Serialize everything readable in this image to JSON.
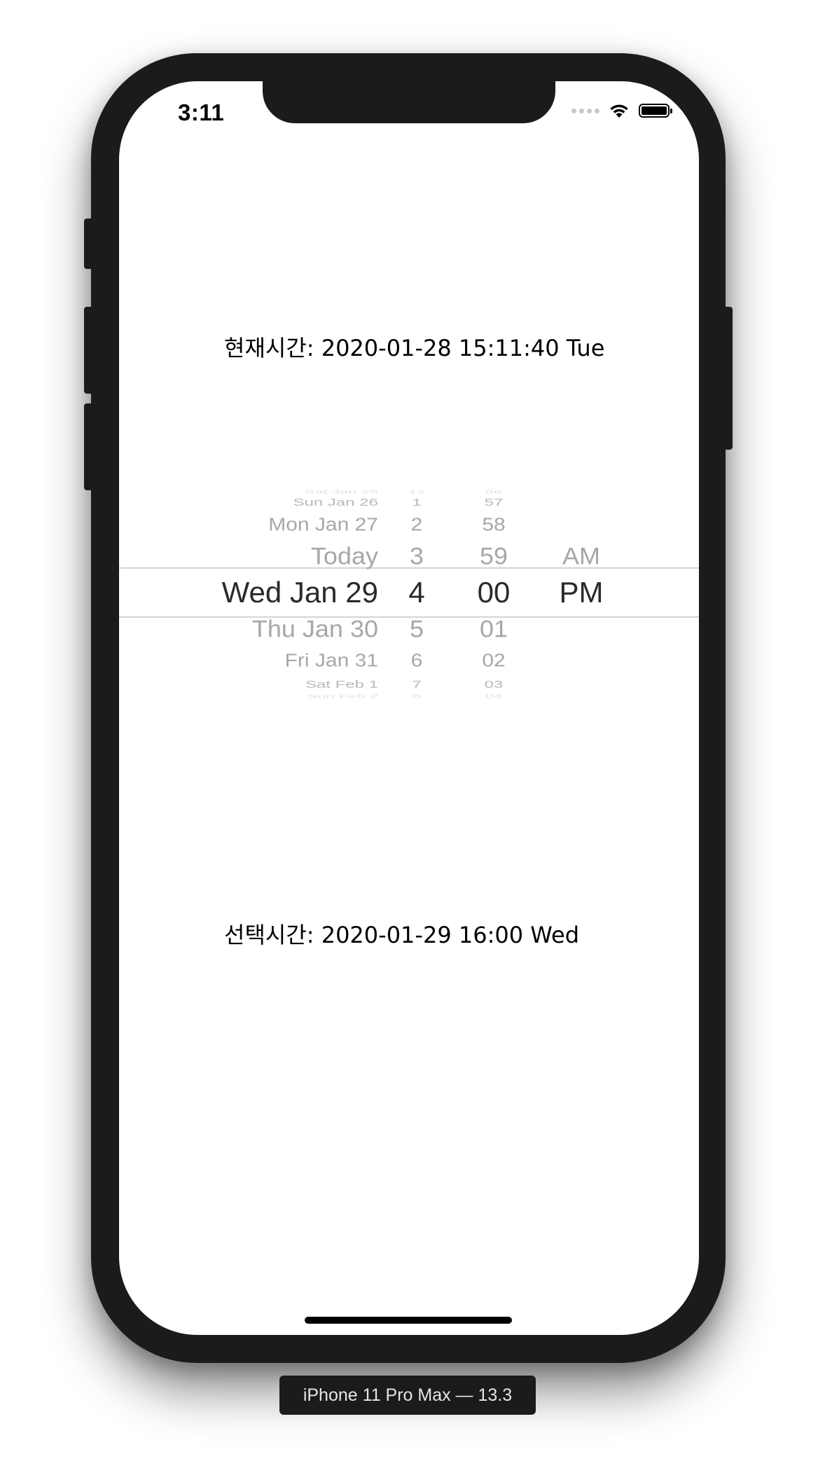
{
  "status_bar": {
    "time": "3:11",
    "icons": [
      "signal-dots-icon",
      "wifi-icon",
      "battery-icon"
    ]
  },
  "current_time": {
    "label": "현재시간: 2020-01-28 15:11:40 Tue"
  },
  "picker": {
    "date_column": {
      "items": [
        "Sat Jan 25",
        "Sun Jan 26",
        "Mon Jan 27",
        "Today",
        "Wed Jan 29",
        "Thu Jan 30",
        "Fri Jan 31",
        "Sat Feb 1",
        "Sun Feb 2"
      ],
      "selected": "Wed Jan 29"
    },
    "hour_column": {
      "items": [
        "12",
        "1",
        "2",
        "3",
        "4",
        "5",
        "6",
        "7",
        "8"
      ],
      "selected": "4"
    },
    "minute_column": {
      "items": [
        "56",
        "57",
        "58",
        "59",
        "00",
        "01",
        "02",
        "03",
        "04"
      ],
      "selected": "00"
    },
    "ampm_column": {
      "items": [
        "AM",
        "PM"
      ],
      "selected": "PM"
    }
  },
  "selected_time": {
    "label": "선택시간: 2020-01-29 16:00 Wed"
  },
  "device_caption": "iPhone 11 Pro Max — 13.3",
  "colors": {
    "device_frame": "#1b1b1c",
    "picker_faded_text": "#a7a7ab",
    "picker_selected_text": "#2a2a2c",
    "picker_divider": "#d4d4d6"
  }
}
